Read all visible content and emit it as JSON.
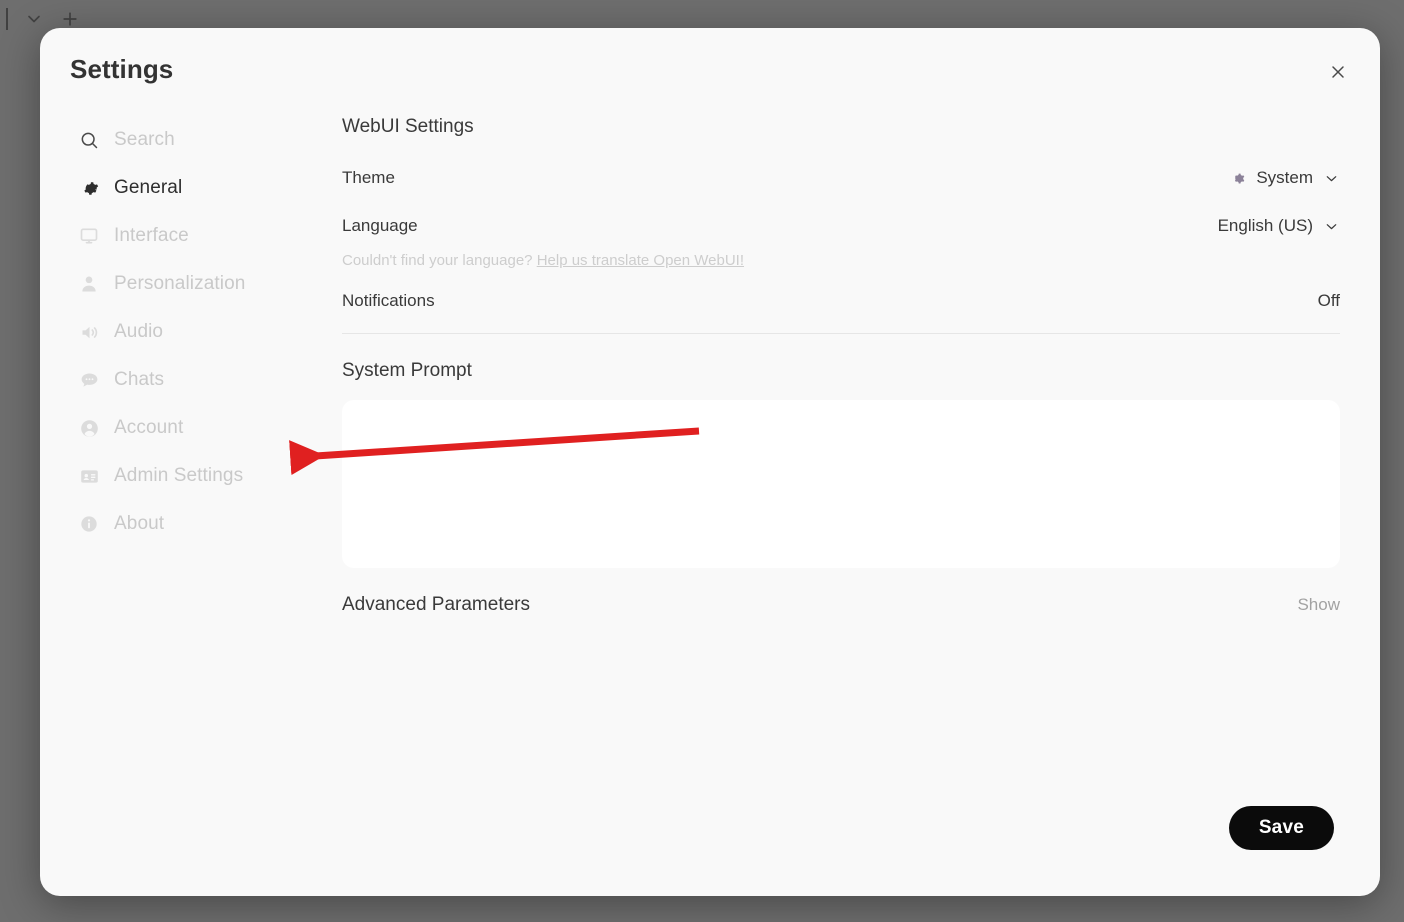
{
  "background": {
    "caret_icon": "text-caret",
    "chevron_icon": "chevron-down-icon",
    "plus_icon": "plus-icon"
  },
  "modal": {
    "title": "Settings",
    "close_icon": "close-icon"
  },
  "sidebar": {
    "items": [
      {
        "label": "Search",
        "icon": "search-icon",
        "active": false
      },
      {
        "label": "General",
        "icon": "gear-icon",
        "active": true
      },
      {
        "label": "Interface",
        "icon": "monitor-icon",
        "active": false
      },
      {
        "label": "Personalization",
        "icon": "person-icon",
        "active": false
      },
      {
        "label": "Audio",
        "icon": "speaker-icon",
        "active": false
      },
      {
        "label": "Chats",
        "icon": "chat-bubble-icon",
        "active": false
      },
      {
        "label": "Account",
        "icon": "user-circle-icon",
        "active": false
      },
      {
        "label": "Admin Settings",
        "icon": "id-card-icon",
        "active": false
      },
      {
        "label": "About",
        "icon": "info-circle-icon",
        "active": false
      }
    ]
  },
  "content": {
    "section_title": "WebUI Settings",
    "theme": {
      "label": "Theme",
      "value": "System",
      "icon": "gear-icon",
      "chevron": "chevron-down-icon"
    },
    "language": {
      "label": "Language",
      "value": "English (US)",
      "chevron": "chevron-down-icon"
    },
    "translate_prompt": "Couldn't find your language?",
    "translate_link": "Help us translate Open WebUI!",
    "notifications": {
      "label": "Notifications",
      "value": "Off"
    },
    "system_prompt": {
      "title": "System Prompt",
      "value": "",
      "placeholder": ""
    },
    "advanced": {
      "label": "Advanced Parameters",
      "toggle_label": "Show"
    }
  },
  "footer": {
    "save_label": "Save"
  },
  "annotation": {
    "arrow_color": "#e02020",
    "points_to": "Admin Settings"
  }
}
